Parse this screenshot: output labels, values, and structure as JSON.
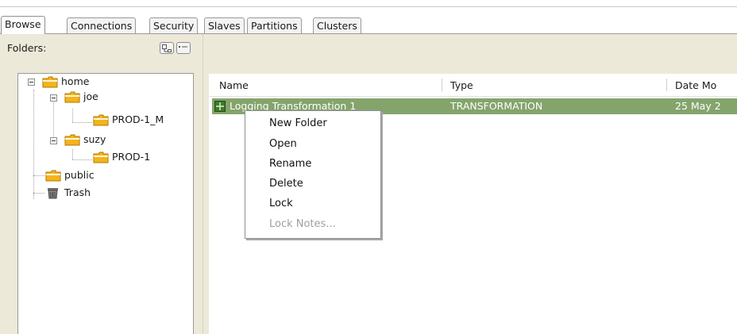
{
  "tabs": [
    "Browse",
    "Connections",
    "Security",
    "Slaves",
    "Partitions",
    "Clusters"
  ],
  "active_tab": "Browse",
  "folders_label": "Folders:",
  "toolbar_icons": [
    "expand-collapse-icon",
    "show-details-icon"
  ],
  "tree": {
    "home": "home",
    "joe": "joe",
    "joe_child": "PROD-1_M",
    "suzy": "suzy",
    "suzy_child": "PROD-1",
    "public": "public",
    "trash": "Trash"
  },
  "grid": {
    "columns": [
      "Name",
      "Type",
      "Date Mo"
    ],
    "rows": [
      {
        "name": "Logging Transformation 1",
        "type": "TRANSFORMATION",
        "date": "25 May 2"
      }
    ]
  },
  "context_menu": {
    "items": [
      "New Folder",
      "Open",
      "Rename",
      "Delete",
      "Lock",
      "Lock Notes..."
    ],
    "disabled": [
      "Lock Notes..."
    ]
  },
  "colors": {
    "selection": "#84a46c",
    "folder": "#f4b41a",
    "panel_bg": "#ece9d8"
  }
}
